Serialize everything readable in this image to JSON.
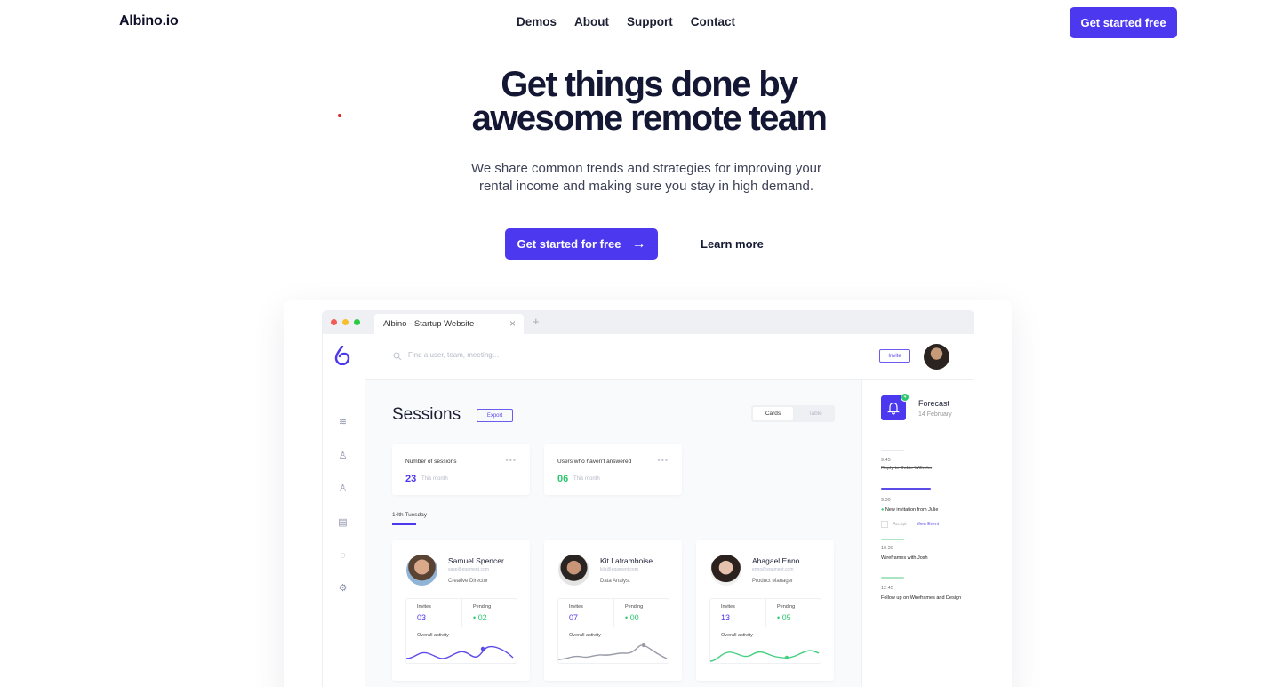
{
  "nav": {
    "logo": "Albino.io",
    "links": [
      "Demos",
      "About",
      "Support",
      "Contact"
    ],
    "cta": "Get started free"
  },
  "hero": {
    "title_line1": "Get things done by",
    "title_line2": "awesome remote team",
    "subtitle": "We share common trends and strategies for improving your rental income and making sure you stay in high demand.",
    "primary_cta": "Get started for free",
    "secondary_cta": "Learn more"
  },
  "browser": {
    "tab_title": "Albino - Startup Website",
    "close_glyph": "×",
    "new_tab_glyph": "+"
  },
  "app": {
    "search_placeholder": "Find a user, team, meeting…",
    "invite_label": "Invite",
    "page_title": "Sessions",
    "export_label": "Export",
    "view_cards": "Cards",
    "view_table": "Table",
    "stats": [
      {
        "label": "Number of sessions",
        "value": "23",
        "period": "This month",
        "color": "#4c38ef"
      },
      {
        "label": "Users  who haven't answered",
        "value": "06",
        "period": "This month",
        "color": "#2fc76f"
      }
    ],
    "day_label": "14th Tuesday",
    "people": [
      {
        "name": "Samuel Spencer",
        "email": "sasp@egament.com",
        "role": "Creative Director",
        "invites_label": "Invites",
        "invites": "03",
        "pending_label": "Pending",
        "pending": "02",
        "activity_label": "Overall activity",
        "line_color": "#5b4be8"
      },
      {
        "name": "Kit Laframboise",
        "email": "kila@egament.com",
        "role": "Data Analyst",
        "invites_label": "Invites",
        "invites": "07",
        "pending_label": "Pending",
        "pending": "00",
        "activity_label": "Overall activity",
        "line_color": "#9a9ca8"
      },
      {
        "name": "Abagael Enno",
        "email": "enno@egament.com",
        "role": "Product Manager",
        "invites_label": "Invites",
        "invites": "13",
        "pending_label": "Pending",
        "pending": "05",
        "activity_label": "Overall activity",
        "line_color": "#45cf80"
      }
    ],
    "forecast": {
      "title": "Forecast",
      "date": "14 February",
      "badge": "4",
      "events": [
        {
          "time": "9:45",
          "text": "Reply to Dobie Wilhelm"
        },
        {
          "time": "9:30",
          "text": "New invitation from Julie",
          "accept": "Accept",
          "view": "View Event"
        },
        {
          "time": "10:30",
          "text": "Wireframes with Josh"
        },
        {
          "time": "12:45",
          "text": "Follow up on Wireframes and Design"
        }
      ]
    }
  }
}
